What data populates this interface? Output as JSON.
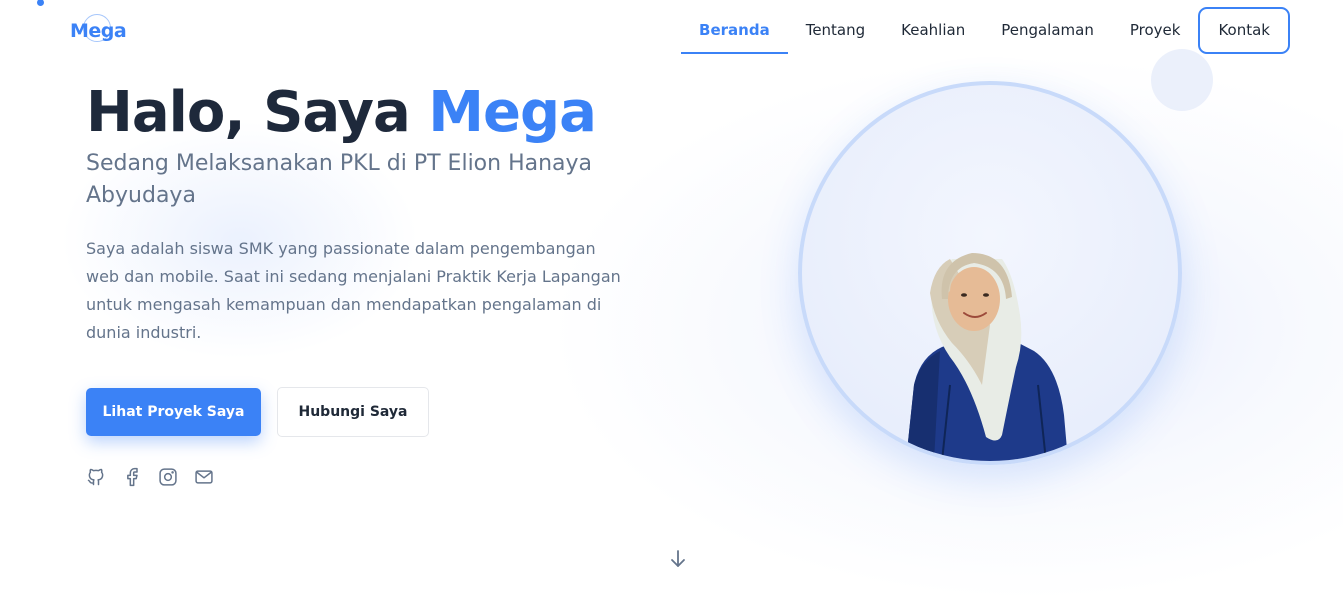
{
  "brand": {
    "logo_text": "Mega",
    "accent_color": "#3b82f6"
  },
  "nav": {
    "items": [
      {
        "label": "Beranda",
        "active": true
      },
      {
        "label": "Tentang",
        "active": false
      },
      {
        "label": "Keahlian",
        "active": false
      },
      {
        "label": "Pengalaman",
        "active": false
      },
      {
        "label": "Proyek",
        "active": false
      },
      {
        "label": "Kontak",
        "active": false
      }
    ]
  },
  "hero": {
    "greeting": "Halo, Saya ",
    "name": "Mega",
    "subtitle": "Sedang Melaksanakan PKL di PT Elion Hanaya Abyudaya",
    "description": "Saya adalah siswa SMK yang passionate dalam pengembangan web dan mobile. Saat ini sedang menjalani Praktik Kerja Lapangan untuk mengasah kemampuan dan mendapatkan pengalaman di dunia industri.",
    "primary_button": "Lihat Proyek Saya",
    "secondary_button": "Hubungi Saya"
  },
  "socials": [
    {
      "icon": "github-icon"
    },
    {
      "icon": "facebook-icon"
    },
    {
      "icon": "instagram-icon"
    },
    {
      "icon": "mail-icon"
    }
  ],
  "profile": {
    "icon": "profile-photo"
  },
  "scroll": {
    "icon": "arrow-down-icon"
  }
}
